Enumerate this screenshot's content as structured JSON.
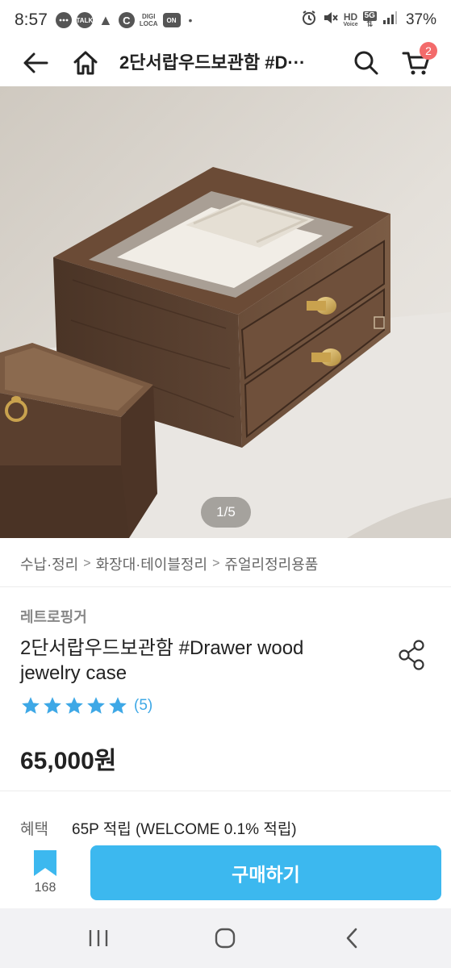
{
  "status_bar": {
    "time": "8:57",
    "left_icons": [
      "chat-icon",
      "talk-icon",
      "warning-icon",
      "c-icon",
      "digi-loca-icon",
      "on-icon"
    ],
    "talk_label": "TALK",
    "c_label": "C",
    "digi_label_1": "DIGI",
    "digi_label_2": "LOCA",
    "on_label": "ON",
    "dot": "•",
    "hd_label": "HD",
    "hd_sub": "Voice",
    "fiveg_label": "5G",
    "battery": "37%"
  },
  "header": {
    "title": "2단서랍우드보관함 #D···",
    "cart_count": "2"
  },
  "gallery": {
    "counter": "1/5"
  },
  "breadcrumb": {
    "items": [
      "수납·정리",
      "화장대·테이블정리",
      "쥬얼리정리용품"
    ],
    "separator": ">"
  },
  "product": {
    "brand": "레트로핑거",
    "title": "2단서랍우드보관함 #Drawer wood jewelry case",
    "rating_stars": 5,
    "review_count": "(5)",
    "price": "65,000원"
  },
  "benefit": {
    "label": "혜택",
    "value": "65P 적립 (WELCOME 0.1% 적립)"
  },
  "bottom": {
    "bookmark_count": "168",
    "buy_label": "구매하기"
  },
  "colors": {
    "accent": "#3cb8ef",
    "star": "#3ea8e6",
    "badge": "#f36b6b",
    "wood": "#5a4030"
  }
}
